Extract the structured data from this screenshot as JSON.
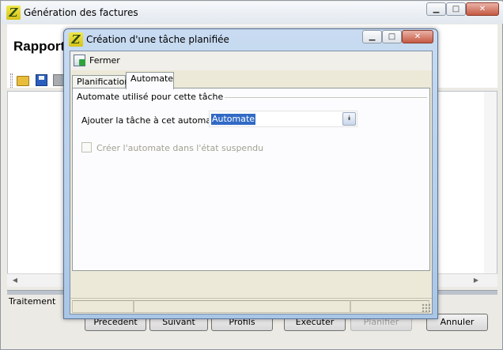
{
  "main_window": {
    "title": "Génération des factures",
    "heading": "Rapport",
    "caption_buttons": {
      "minimize": "▁",
      "maximize": "□",
      "close": "✕"
    },
    "traitement_label": "Traitement",
    "buttons": {
      "precedent": "Précédent",
      "suivant": "Suivant",
      "profils": "Profils",
      "executer": "Exécuter",
      "planifier": "Planifier",
      "annuler": "Annuler"
    }
  },
  "dialog": {
    "title": "Création d'une tâche planifiée",
    "caption_buttons": {
      "minimize": "▁",
      "maximize": "□",
      "close": "✕"
    },
    "toolbar": {
      "close_label": "Fermer"
    },
    "tabs": [
      {
        "label": "Planification",
        "active": false
      },
      {
        "label": "Automate",
        "active": true
      }
    ],
    "panel": {
      "group_title": "Automate utilisé pour cette tâche",
      "field_label": "Ajouter la tâche à cet automate :",
      "select_value": "Automate",
      "select_arrow": "⯯",
      "checkbox_label": "Créer l'automate dans l'état suspendu",
      "checkbox_checked": false,
      "checkbox_enabled": false
    }
  },
  "icons": {
    "app": "Z",
    "scroll_left": "◀",
    "scroll_right": "▶"
  },
  "colors": {
    "selection": "#316ac5",
    "dialog_frame": "#aac6e6"
  }
}
